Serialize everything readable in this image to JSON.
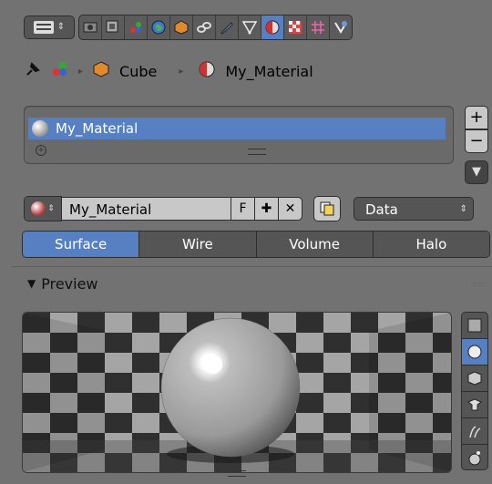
{
  "header": {
    "context_icon": "screen-layout-icon",
    "tabs": [
      {
        "name": "render-icon",
        "active": false
      },
      {
        "name": "render-layers-icon",
        "active": false
      },
      {
        "name": "scene-icon",
        "active": false
      },
      {
        "name": "world-icon",
        "active": false
      },
      {
        "name": "object-icon",
        "active": false
      },
      {
        "name": "constraints-icon",
        "active": false
      },
      {
        "name": "modifiers-icon",
        "active": false
      },
      {
        "name": "data-icon",
        "active": false
      },
      {
        "name": "material-icon",
        "active": true
      },
      {
        "name": "texture-icon",
        "active": false
      },
      {
        "name": "particles-icon",
        "active": false
      },
      {
        "name": "physics-icon",
        "active": false
      }
    ]
  },
  "breadcrumb": {
    "object": "Cube",
    "material": "My_Material"
  },
  "material_list": {
    "items": [
      "My_Material"
    ]
  },
  "material_row": {
    "name": "My_Material",
    "fake_user_label": "F",
    "link_label": "Data"
  },
  "tabs": [
    "Surface",
    "Wire",
    "Volume",
    "Halo"
  ],
  "active_tab": "Surface",
  "preview": {
    "title": "Preview",
    "active_shape": "sphere"
  },
  "colors": {
    "accent": "#5680c2",
    "panel": "#727272"
  }
}
